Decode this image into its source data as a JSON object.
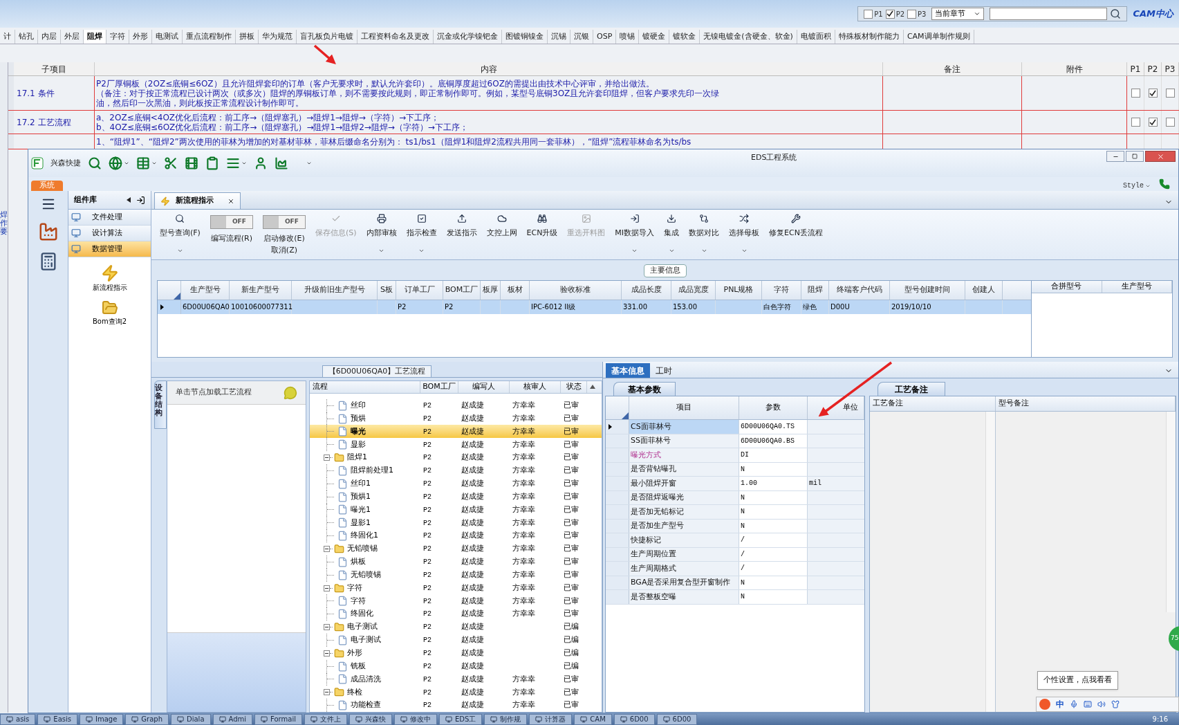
{
  "background_app": {
    "filters": [
      {
        "label": "P1",
        "checked": false
      },
      {
        "label": "P2",
        "checked": true
      },
      {
        "label": "P3",
        "checked": false
      }
    ],
    "chapter_select": {
      "value": "当前章节"
    },
    "logo_text": "CAM中心",
    "chapter_tabs": [
      {
        "label": "计",
        "selected": false
      },
      {
        "label": "钻孔",
        "selected": false
      },
      {
        "label": "内层",
        "selected": false
      },
      {
        "label": "外层",
        "selected": false
      },
      {
        "label": "阻焊",
        "selected": true
      },
      {
        "label": "字符",
        "selected": false
      },
      {
        "label": "外形",
        "selected": false
      },
      {
        "label": "电测试",
        "selected": false
      },
      {
        "label": "重点流程制作",
        "selected": false
      },
      {
        "label": "拼板",
        "selected": false
      },
      {
        "label": "华为规范",
        "selected": false
      },
      {
        "label": "盲孔板负片电镀",
        "selected": false
      },
      {
        "label": "工程资料命名及更改",
        "selected": false
      },
      {
        "label": "沉金或化学镍钯金",
        "selected": false
      },
      {
        "label": "图镀铜镍金",
        "selected": false
      },
      {
        "label": "沉锡",
        "selected": false
      },
      {
        "label": "沉银",
        "selected": false
      },
      {
        "label": "OSP",
        "selected": false
      },
      {
        "label": "喷锡",
        "selected": false
      },
      {
        "label": "镀硬金",
        "selected": false
      },
      {
        "label": "镀软金",
        "selected": false
      },
      {
        "label": "无镍电镀金(含硬金、软金)",
        "selected": false
      },
      {
        "label": "电镀面积",
        "selected": false
      },
      {
        "label": "特殊板材制作能力",
        "selected": false
      },
      {
        "label": "CAM调单制作规则",
        "selected": false
      }
    ],
    "side_text": "焊作要",
    "table": {
      "columns": [
        "子项目",
        "内容",
        "备注",
        "附件",
        "P1",
        "P2",
        "P3"
      ],
      "rows": [
        {
          "item": "17.1 条件",
          "content": [
            "P2厂厚铜板（2OZ≤底铜≤6OZ）且允许阻焊套印的订单（客户无要求时，默认允许套印）。底铜厚度超过6OZ的需提出由技术中心评审，并给出做法。",
            "（备注：对于按正常流程已设计两次（或多次）阻焊的厚铜板订单，则不需要按此规则，即正常制作即可。例如，某型号底铜3OZ且允许套印阻焊，但客户要求先印一次绿",
            "油，然后印一次黑油，则此板按正常流程设计制作即可。"
          ],
          "p1": false,
          "p2": true,
          "p3": false
        },
        {
          "item": "17.2 工艺流程",
          "content": [
            "a、2OZ≤底铜<4OZ优化后流程：前工序→（阻焊塞孔）→阻焊1→阻焊→（字符）→下工序；",
            "b、4OZ≤底铜≤6OZ优化后流程：前工序→（阻焊塞孔）→阻焊1→阻焊2→阻焊→（字符）→下工序；"
          ],
          "p1": false,
          "p2": true,
          "p3": false
        },
        {
          "content": [
            "1、“阻焊1”、“阻焊2”两次使用的菲林为增加的对基材菲林，菲林后缀命名分别为： ts1/bs1（阻焊1和阻焊2流程共用同一套菲林），“阻焊”流程菲林命名为ts/bs"
          ]
        }
      ]
    }
  },
  "window": {
    "title": "EDS工程系统",
    "brand": "兴森快捷",
    "system_tab": "系统",
    "style_menu": "Style",
    "nav": {
      "title": "组件库",
      "items": [
        {
          "label": "文件处理",
          "selected": false
        },
        {
          "label": "设计算法",
          "selected": false
        },
        {
          "label": "数据管理",
          "selected": true
        }
      ],
      "tools": [
        {
          "label": "新流程指示"
        },
        {
          "label": "Bom查询2"
        }
      ]
    },
    "doc_tab": {
      "label": "新流程指示"
    },
    "ribbon": [
      {
        "kind": "button",
        "label": "型号查询(F)",
        "menu": true,
        "disabled": false
      },
      {
        "kind": "toggle",
        "label": "编写流程(R)",
        "switch_text": "OFF",
        "on": false
      },
      {
        "kind": "toggle",
        "label": "启动修改(E)",
        "sublabel": "取消(Z)",
        "switch_text": "OFF",
        "on": false
      },
      {
        "kind": "button",
        "label": "保存信息(S)",
        "menu": false,
        "disabled": true
      },
      {
        "kind": "button",
        "label": "内部审核",
        "menu": true,
        "disabled": false
      },
      {
        "kind": "button",
        "label": "指示检查",
        "menu": true,
        "disabled": false
      },
      {
        "kind": "button",
        "label": "发送指示",
        "menu": false,
        "disabled": false
      },
      {
        "kind": "button",
        "label": "文控上网",
        "menu": false,
        "disabled": false
      },
      {
        "kind": "button",
        "label": "ECN升级",
        "menu": false,
        "disabled": false
      },
      {
        "kind": "button",
        "label": "重选开料图",
        "menu": false,
        "disabled": true
      },
      {
        "kind": "button",
        "label": "MI数据导入",
        "menu": true,
        "disabled": false
      },
      {
        "kind": "button",
        "label": "集成",
        "menu": true,
        "disabled": false
      },
      {
        "kind": "button",
        "label": "数据对比",
        "menu": true,
        "disabled": false
      },
      {
        "kind": "button",
        "label": "选择母板",
        "menu": true,
        "disabled": false
      },
      {
        "kind": "button",
        "label": "修复ECN丢流程",
        "menu": false,
        "disabled": false
      }
    ],
    "main_info": {
      "title": "主要信息",
      "columns": [
        "生产型号",
        "新生产型号",
        "升级前旧生产型号",
        "S板",
        "订单工厂",
        "BOM工厂",
        "板厚",
        "板材",
        "验收标准",
        "成品长度",
        "成品宽度",
        "PNL规格",
        "字符",
        "阻焊",
        "终端客户代码",
        "型号创建时间",
        "创建人"
      ],
      "rows": [
        {
          "selected": true,
          "cells": [
            {
              "text": "6D00U06QA0"
            },
            {
              "text": "10010600077311"
            },
            {},
            {},
            {
              "text": "P2"
            },
            {
              "text": "P2"
            },
            {},
            {},
            {
              "text": "IPC-6012 II级"
            },
            {
              "text": "331.00"
            },
            {
              "text": "153.00"
            },
            {},
            {
              "text": "白色字符"
            },
            {
              "text": "绿色"
            },
            {
              "text": "D00U"
            },
            {
              "text": "2019/10/10"
            },
            {}
          ]
        }
      ],
      "side_columns": [
        "合拼型号",
        "生产型号"
      ]
    },
    "flow_panel": {
      "title": "【6D00U06QA0】工艺流程",
      "side_tab": "设备结构",
      "hint": "单击节点加载工艺流程",
      "columns": [
        "流程",
        "BOM工厂",
        "编写人",
        "核审人",
        "状态"
      ],
      "tree": [
        {
          "children": [
            {
              "name": "丝印",
              "bom": "P2",
              "writer": "赵成捷",
              "reviewer": "方幸幸",
              "status": "已审",
              "selected": false
            },
            {
              "name": "预烘",
              "bom": "P2",
              "writer": "赵成捷",
              "reviewer": "方幸幸",
              "status": "已审",
              "selected": false
            },
            {
              "name": "曝光",
              "bom": "P2",
              "writer": "赵成捷",
              "reviewer": "方幸幸",
              "status": "已审",
              "selected": true
            },
            {
              "name": "显影",
              "bom": "P2",
              "writer": "赵成捷",
              "reviewer": "方幸幸",
              "status": "已审",
              "selected": false
            }
          ]
        },
        {
          "name": "阻焊1",
          "bom": "P2",
          "writer": "赵成捷",
          "reviewer": "方幸幸",
          "status": "已审",
          "selected": false,
          "children": [
            {
              "name": "阻焊前处理1",
              "bom": "P2",
              "writer": "赵成捷",
              "reviewer": "方幸幸",
              "status": "已审",
              "selected": false
            },
            {
              "name": "丝印1",
              "bom": "P2",
              "writer": "赵成捷",
              "reviewer": "方幸幸",
              "status": "已审",
              "selected": false
            },
            {
              "name": "预烘1",
              "bom": "P2",
              "writer": "赵成捷",
              "reviewer": "方幸幸",
              "status": "已审",
              "selected": false
            },
            {
              "name": "曝光1",
              "bom": "P2",
              "writer": "赵成捷",
              "reviewer": "方幸幸",
              "status": "已审",
              "selected": false
            },
            {
              "name": "显影1",
              "bom": "P2",
              "writer": "赵成捷",
              "reviewer": "方幸幸",
              "status": "已审",
              "selected": false
            },
            {
              "name": "终固化1",
              "bom": "P2",
              "writer": "赵成捷",
              "reviewer": "方幸幸",
              "status": "已审",
              "selected": false
            }
          ]
        },
        {
          "name": "无铅喷锡",
          "bom": "P2",
          "writer": "赵成捷",
          "reviewer": "方幸幸",
          "status": "已审",
          "selected": false,
          "children": [
            {
              "name": "烘板",
              "bom": "P2",
              "writer": "赵成捷",
              "reviewer": "方幸幸",
              "status": "已审",
              "selected": false
            },
            {
              "name": "无铅喷锡",
              "bom": "P2",
              "writer": "赵成捷",
              "reviewer": "方幸幸",
              "status": "已审",
              "selected": false
            }
          ]
        },
        {
          "name": "字符",
          "bom": "P2",
          "writer": "赵成捷",
          "reviewer": "方幸幸",
          "status": "已审",
          "selected": false,
          "children": [
            {
              "name": "字符",
              "bom": "P2",
              "writer": "赵成捷",
              "reviewer": "方幸幸",
              "status": "已审",
              "selected": false
            },
            {
              "name": "终固化",
              "bom": "P2",
              "writer": "赵成捷",
              "reviewer": "方幸幸",
              "status": "已审",
              "selected": false
            }
          ]
        },
        {
          "name": "电子测试",
          "bom": "P2",
          "writer": "赵成捷",
          "status": "已编",
          "selected": false,
          "children": [
            {
              "name": "电子测试",
              "bom": "P2",
              "writer": "赵成捷",
              "status": "已编",
              "selected": false
            }
          ]
        },
        {
          "name": "外形",
          "bom": "P2",
          "writer": "赵成捷",
          "status": "已编",
          "selected": false,
          "children": [
            {
              "name": "铣板",
              "bom": "P2",
              "writer": "赵成捷",
              "status": "已编",
              "selected": false
            },
            {
              "name": "成品清洗",
              "bom": "P2",
              "writer": "赵成捷",
              "reviewer": "方幸幸",
              "status": "已审",
              "selected": false
            }
          ]
        },
        {
          "name": "终检",
          "bom": "P2",
          "writer": "赵成捷",
          "reviewer": "方幸幸",
          "status": "已审",
          "selected": false,
          "children": [
            {
              "name": "功能检查",
              "bom": "P2",
              "writer": "赵成捷",
              "reviewer": "方幸幸",
              "status": "已审",
              "selected": false
            }
          ]
        }
      ]
    },
    "info_panel": {
      "tabs": [
        {
          "label": "基本信息",
          "selected": true
        },
        {
          "label": "工时",
          "selected": false
        }
      ],
      "sub_tab": "基本参数",
      "columns": [
        "项目",
        "参数",
        "单位"
      ],
      "params": [
        {
          "item": "CS面菲林号",
          "value": "6D00U06QA0.TS",
          "selected": true,
          "highlighted": false
        },
        {
          "item": "SS面菲林号",
          "value": "6D00U06QA0.BS",
          "selected": false,
          "highlighted": false
        },
        {
          "item": "曝光方式",
          "value": "DI",
          "selected": false,
          "highlighted": true
        },
        {
          "item": "是否背钻曝孔",
          "value": "N",
          "selected": false,
          "highlighted": false
        },
        {
          "item": "最小阻焊开窗",
          "value": "1.00",
          "unit": "mil",
          "selected": false,
          "highlighted": false
        },
        {
          "item": "是否阻焊返曝光",
          "value": "N",
          "selected": false,
          "highlighted": false
        },
        {
          "item": "是否加无铅标记",
          "value": "N",
          "selected": false,
          "highlighted": false
        },
        {
          "item": "是否加生产型号",
          "value": "N",
          "selected": false,
          "highlighted": false
        },
        {
          "item": "快捷标记",
          "value": "/",
          "selected": false,
          "highlighted": false
        },
        {
          "item": "生产周期位置",
          "value": "/",
          "selected": false,
          "highlighted": false
        },
        {
          "item": "生产周期格式",
          "value": "/",
          "selected": false,
          "highlighted": false
        },
        {
          "item": "BGA是否采用复合型开窗制作",
          "value": "N",
          "selected": false,
          "highlighted": false
        },
        {
          "item": "是否整板空曝",
          "value": "N",
          "selected": false,
          "highlighted": false
        }
      ],
      "notes_tab": "工艺备注",
      "notes_columns": [
        "工艺备注",
        "型号备注"
      ]
    }
  },
  "tooltip": "个性设置，点我看看",
  "ime": {
    "mode": "中"
  },
  "edge_badge": "75",
  "taskbar": {
    "items": [
      "asis",
      "Easis",
      "Image",
      "Graph",
      "Diala",
      "Admi",
      "Formail",
      "文件上",
      "兴森快",
      "修改中",
      "EDS工",
      "制作规",
      "计算器",
      "CAM",
      "6D00",
      "6D00"
    ],
    "clock": "9:16"
  }
}
